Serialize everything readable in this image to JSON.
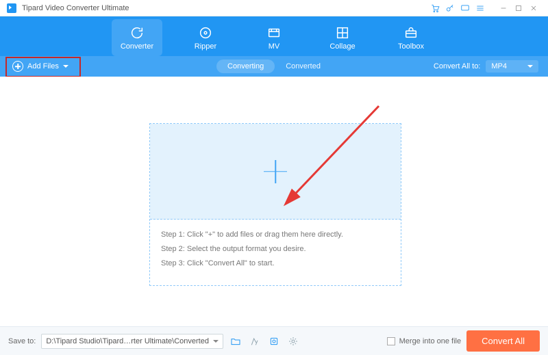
{
  "app": {
    "title": "Tipard Video Converter Ultimate"
  },
  "nav": {
    "items": [
      {
        "label": "Converter"
      },
      {
        "label": "Ripper"
      },
      {
        "label": "MV"
      },
      {
        "label": "Collage"
      },
      {
        "label": "Toolbox"
      }
    ]
  },
  "subbar": {
    "add_files": "Add Files",
    "tab_converting": "Converting",
    "tab_converted": "Converted",
    "convert_all_to": "Convert All to:",
    "format": "MP4"
  },
  "dropzone": {
    "step1": "Step 1: Click \"+\" to add files or drag them here directly.",
    "step2": "Step 2: Select the output format you desire.",
    "step3": "Step 3: Click \"Convert All\" to start."
  },
  "footer": {
    "save_to": "Save to:",
    "path": "D:\\Tipard Studio\\Tipard…rter Ultimate\\Converted",
    "merge": "Merge into one file",
    "convert_all": "Convert All"
  }
}
